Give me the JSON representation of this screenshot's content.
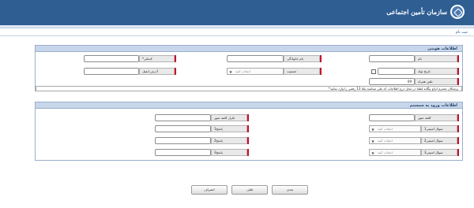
{
  "header": {
    "org_name": "سازمان تأمین اجتماعی",
    "logo_icon": "ssl-emblem-icon"
  },
  "page": {
    "title": "ثبت نام"
  },
  "personal": {
    "section_title": "اطلاعات هویتی",
    "name": {
      "label": "نام",
      "value": ""
    },
    "family": {
      "label": "نام خانوادگی",
      "value": ""
    },
    "national_code": {
      "label": "*کدملی",
      "value": ""
    },
    "birth_date": {
      "label": "تاریخ تولد",
      "value": ""
    },
    "gender": {
      "label": "جنسیت",
      "placeholder": "انتخاب کنید"
    },
    "email": {
      "label": "آدرس ایمیل",
      "value": ""
    },
    "mobile": {
      "label": "تلفن همراه",
      "value": "09"
    },
    "note": "*پزشکان محترم اتباع بیگانه لطفا در محل درج اطلاعات کد ملی شناسه یکتا 13 رقمی را وارد نمایید"
  },
  "login": {
    "section_title": "اطلاعات ورود به سیستم",
    "password": {
      "label": "کلمه عبور",
      "value": ""
    },
    "confirm_password": {
      "label": "تکرار کلمه عبور",
      "value": ""
    },
    "security_questions": [
      {
        "label": "سوال امنیتی1",
        "placeholder": "انتخاب کنید",
        "answer_label": "پاسخ1",
        "answer_value": ""
      },
      {
        "label": "سوال امنیتی2",
        "placeholder": "انتخاب کنید",
        "answer_label": "پاسخ2",
        "answer_value": ""
      },
      {
        "label": "سوال امنیتی3",
        "placeholder": "انتخاب کنید",
        "answer_label": "پاسخ3",
        "answer_value": ""
      }
    ]
  },
  "buttons": {
    "next": "بعدی",
    "prev": "قبلی",
    "cancel": "انصراف"
  },
  "colors": {
    "header_bg": "#2f5e93",
    "required_marker": "#c8102e",
    "section_header_bg": "#c7d6ea"
  }
}
